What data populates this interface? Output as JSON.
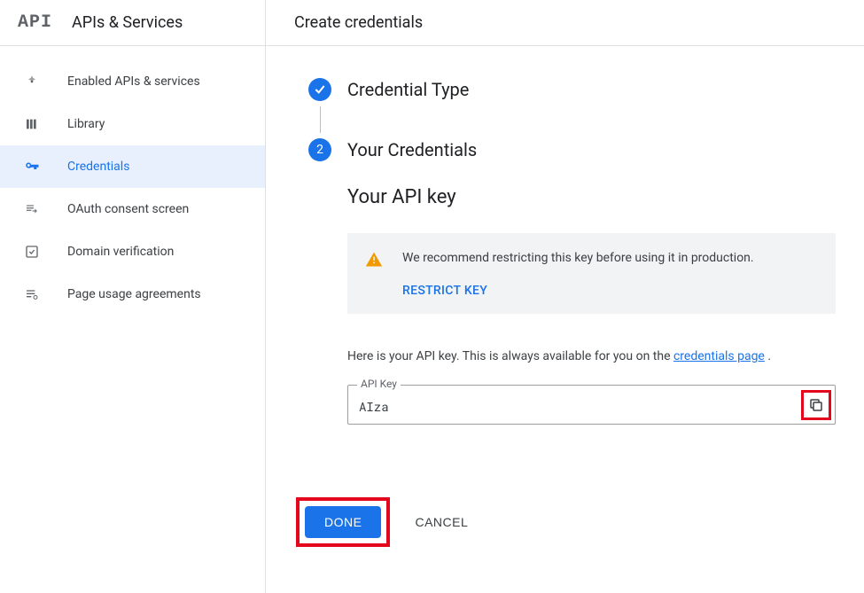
{
  "sidebar": {
    "logo_text": "API",
    "title": "APIs & Services",
    "items": [
      {
        "label": "Enabled APIs & services"
      },
      {
        "label": "Library"
      },
      {
        "label": "Credentials"
      },
      {
        "label": "OAuth consent screen"
      },
      {
        "label": "Domain verification"
      },
      {
        "label": "Page usage agreements"
      }
    ],
    "active_index": 2
  },
  "main": {
    "title": "Create credentials",
    "steps": [
      {
        "title": "Credential Type",
        "done": true
      },
      {
        "title": "Your Credentials",
        "number": "2"
      }
    ],
    "section_heading": "Your API key",
    "warning": {
      "text": "We recommend restricting this key before using it in production.",
      "action_label": "RESTRICT KEY"
    },
    "description_prefix": "Here is your API key. This is always available for you on the ",
    "description_link_text": "credentials page",
    "description_suffix": " .",
    "apikey": {
      "label": "API Key",
      "visible_prefix": "AIza"
    },
    "buttons": {
      "done": "DONE",
      "cancel": "CANCEL"
    }
  }
}
